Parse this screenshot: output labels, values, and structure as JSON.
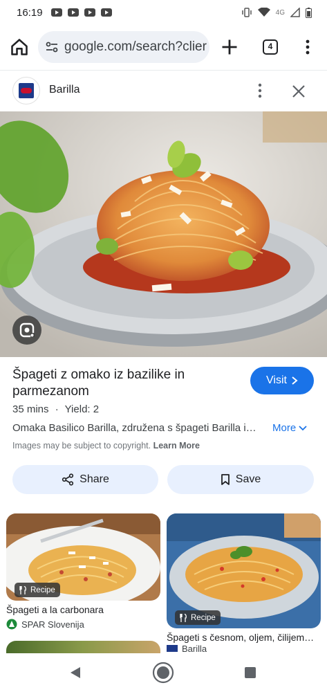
{
  "status_bar": {
    "time": "16:19",
    "network": "4G"
  },
  "browser": {
    "url": "google.com/search?clier",
    "tab_count": "4"
  },
  "site": {
    "name": "Barilla"
  },
  "result": {
    "title": "Špageti z omako iz bazilike in parmezanom",
    "visit_label": "Visit",
    "duration": "35 mins",
    "separator": "·",
    "yield": "Yield: 2",
    "description": "Omaka Basilico Barilla, združena s špageti Barilla i…",
    "more_label": "More",
    "copyright_text": "Images may be subject to copyright.",
    "learn_more": "Learn More",
    "share_label": "Share",
    "save_label": "Save"
  },
  "related": [
    {
      "badge": "Recipe",
      "title": "Špageti a la carbonara",
      "source": "SPAR Slovenija"
    },
    {
      "badge": "Recipe",
      "title": "Špageti s česnom, oljem, čilijem…",
      "source": "Barilla"
    }
  ],
  "icons": {
    "home": "home-icon",
    "tune": "site-settings-icon",
    "new_tab": "plus-icon",
    "menu": "more-vert-icon",
    "close": "close-icon",
    "lens": "lens-icon",
    "chevron": "chevron-right-icon",
    "share": "share-icon",
    "bookmark": "bookmark-icon",
    "utensils": "utensils-icon",
    "back": "back-icon",
    "nav_home": "nav-home-icon",
    "recents": "recents-icon"
  },
  "colors": {
    "accent": "#1a73e8",
    "chip_bg": "#e8f0fe",
    "omnibox_bg": "#eef1f6"
  }
}
